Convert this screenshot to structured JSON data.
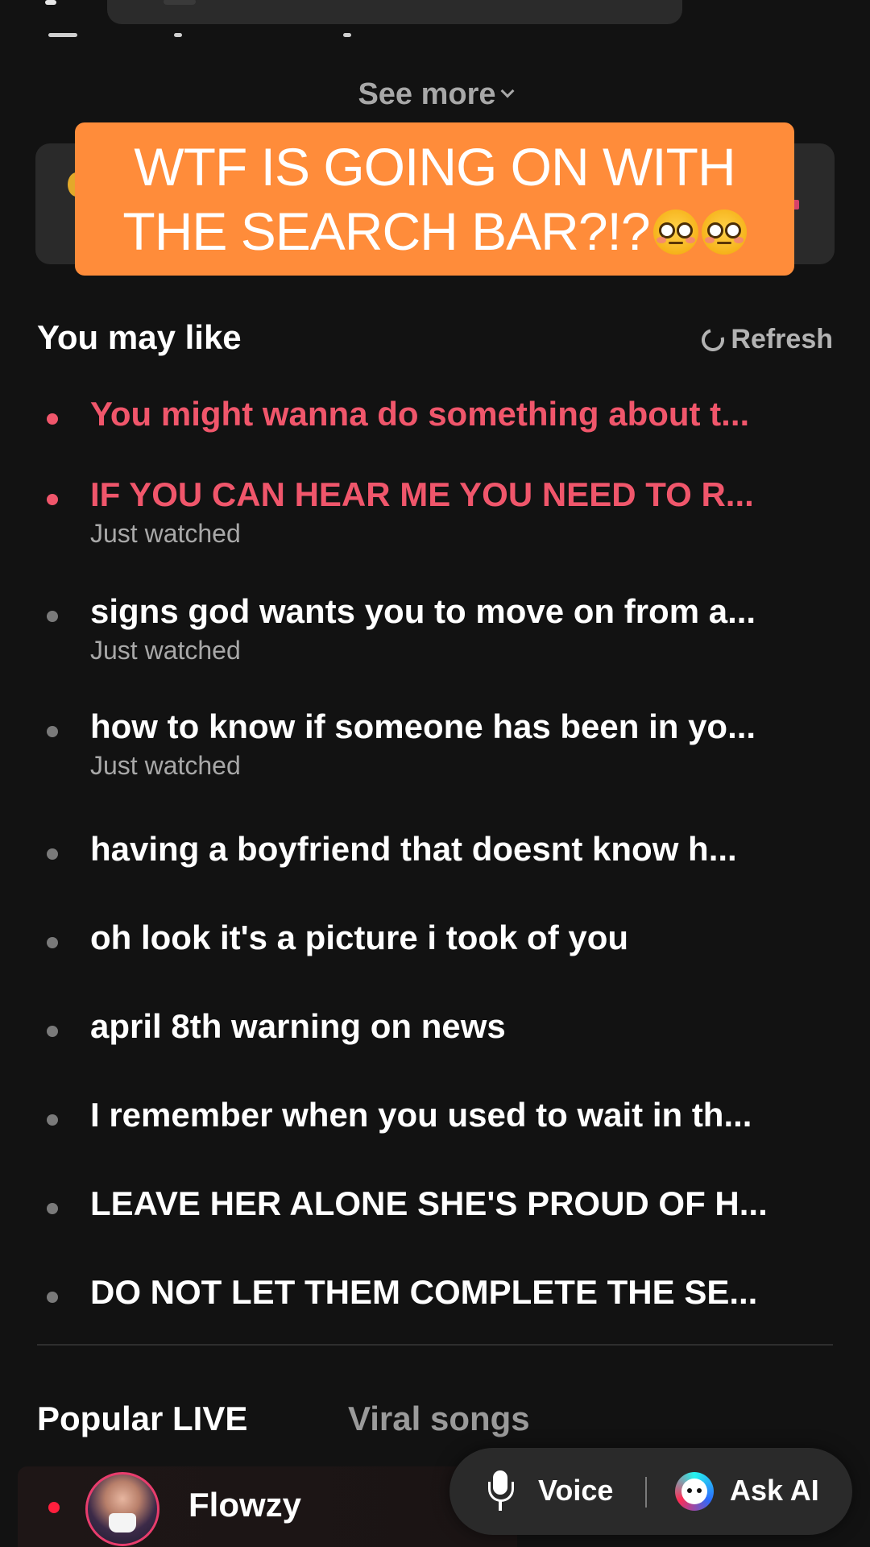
{
  "see_more": "See more",
  "banner": {
    "line1": "WTF IS GOING ON WITH",
    "line2": "THE SEARCH BAR?!?",
    "emoji_icon": "flushed-face-emoji"
  },
  "suggestions": {
    "title": "You may like",
    "refresh_label": "Refresh",
    "items": [
      {
        "text": "You might wanna do something about t...",
        "sub": "",
        "highlight": true
      },
      {
        "text": "IF YOU CAN HEAR ME YOU NEED TO R...",
        "sub": "Just watched",
        "highlight": true
      },
      {
        "text": "signs god wants you to move on from a...",
        "sub": "Just watched",
        "highlight": false
      },
      {
        "text": "how to know if someone has been in yo...",
        "sub": "Just watched",
        "highlight": false
      },
      {
        "text": "having a boyfriend that doesnt know h...",
        "sub": "",
        "highlight": false
      },
      {
        "text": "oh look it's a picture i took of you",
        "sub": "",
        "highlight": false
      },
      {
        "text": "april 8th warning on news",
        "sub": "",
        "highlight": false
      },
      {
        "text": "I remember when you used to wait in th...",
        "sub": "",
        "highlight": false
      },
      {
        "text": "LEAVE HER ALONE SHE'S PROUD OF H...",
        "sub": "",
        "highlight": false
      },
      {
        "text": "DO NOT LET THEM COMPLETE THE SE...",
        "sub": "",
        "highlight": false
      }
    ]
  },
  "tabs": {
    "popular_live": "Popular LIVE",
    "viral_songs": "Viral songs"
  },
  "live": {
    "name": "Flowzy"
  },
  "assist": {
    "voice_label": "Voice",
    "ask_ai_label": "Ask AI"
  },
  "colors": {
    "background": "#121212",
    "banner": "#ff8c3a",
    "highlight": "#f0566b",
    "muted": "#a8a8a8",
    "live_dot": "#ff1f3d"
  }
}
